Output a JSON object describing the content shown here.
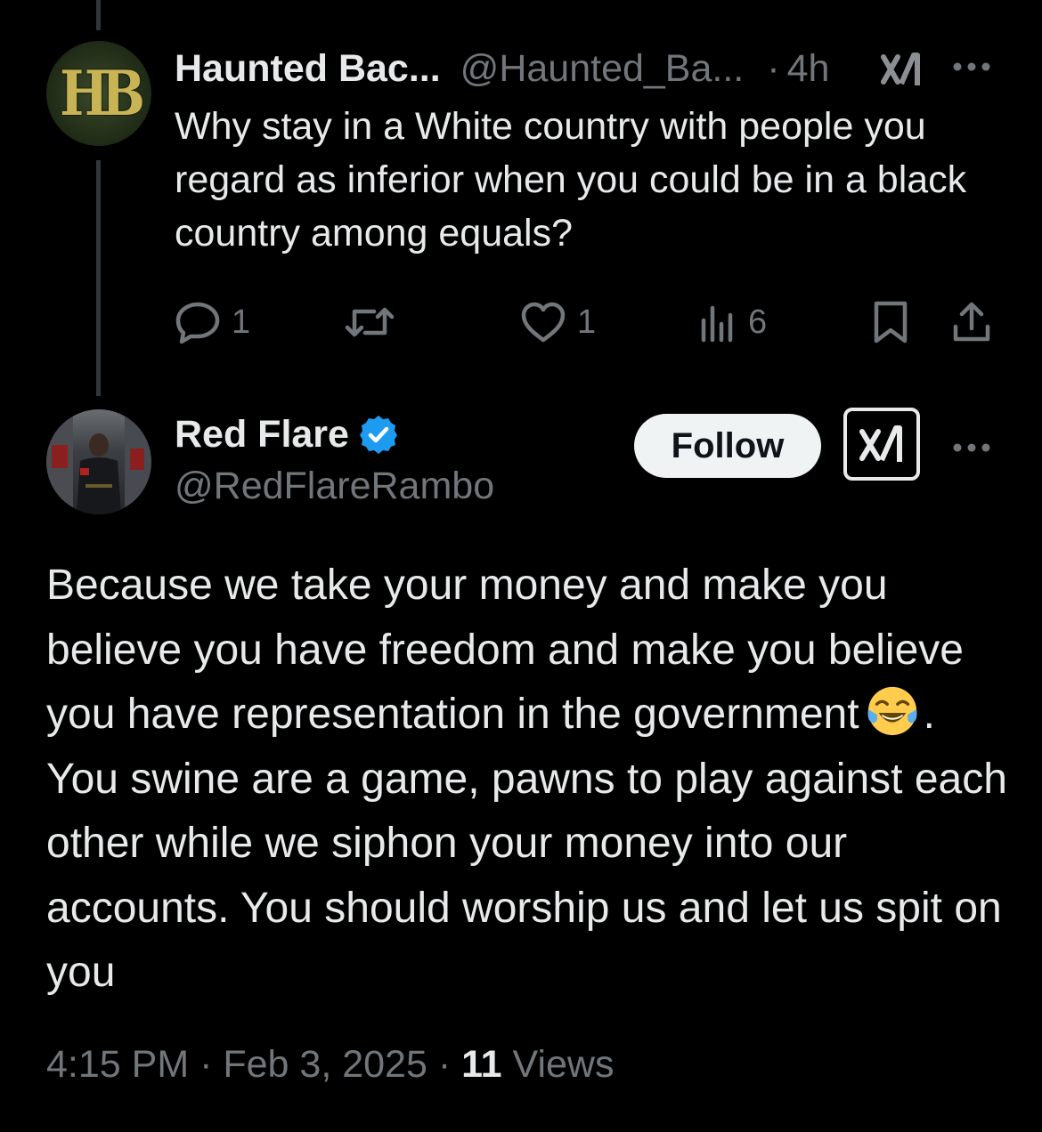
{
  "parent_tweet": {
    "avatar_text": "HB",
    "display_name": "Haunted Bac...",
    "handle": "@Haunted_Ba...",
    "separator": "·",
    "time": "4h",
    "body": "Why stay in a White country with people you regard as inferior when you could be in a black country among equals?",
    "replies": "1",
    "likes": "1",
    "views": "6"
  },
  "reply_tweet": {
    "display_name": "Red Flare",
    "handle": "@RedFlareRambo",
    "follow_label": "Follow",
    "body_part1": "Because we take your money and make you believe you have freedom and make you believe you have representation in the government",
    "emoji": "face-with-tears-of-joy",
    "body_part2": ". You swine are a game, pawns to play against each other while we siphon your money into our accounts. You should worship us and let us spit on you",
    "time": "4:15 PM",
    "separator": "·",
    "date": "Feb 3, 2025",
    "views_count": "11",
    "views_label": "Views"
  },
  "colors": {
    "background": "#000000",
    "text": "#e7e9ea",
    "muted": "#71767b",
    "verified": "#1d9bf0",
    "thread_line": "#333639"
  }
}
